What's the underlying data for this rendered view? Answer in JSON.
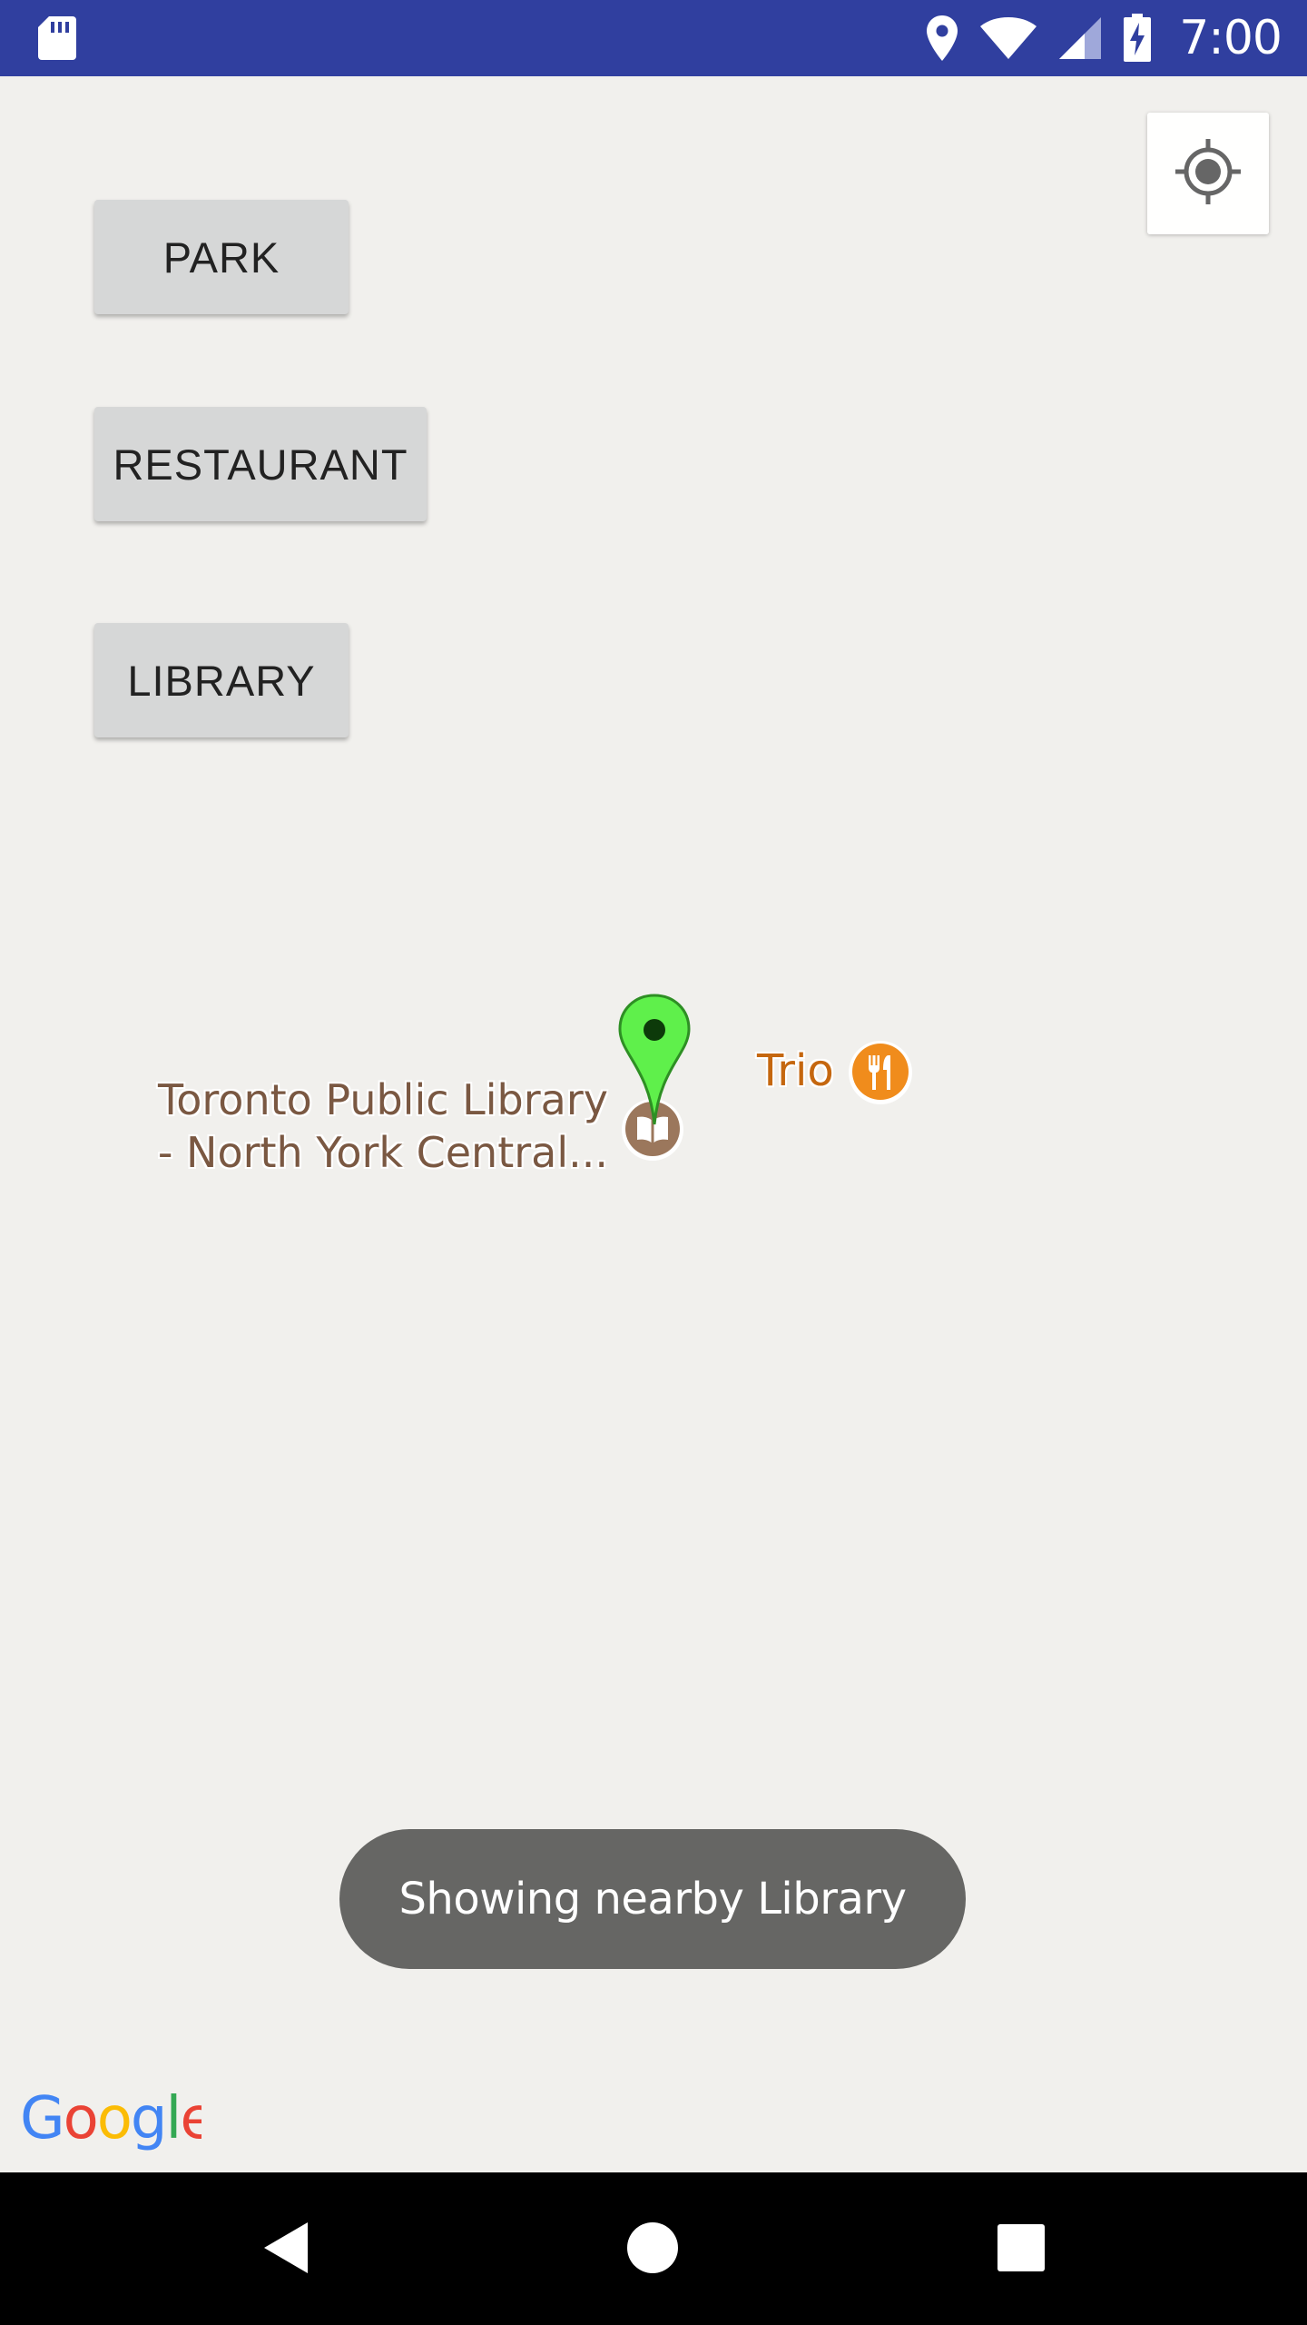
{
  "status_bar": {
    "time": "7:00",
    "icons": [
      "sd-card-icon",
      "location-icon",
      "wifi-icon",
      "signal-icon",
      "battery-charging-icon"
    ],
    "background": "#303f9f"
  },
  "map": {
    "my_location_icon": "my-location-icon",
    "buttons": [
      {
        "label": "PARK"
      },
      {
        "label": "RESTAURANT"
      },
      {
        "label": "LIBRARY"
      }
    ],
    "pois": {
      "library": {
        "line1": "Toronto Public Library",
        "line2": "- North York Central...",
        "icon": "book-icon",
        "color": "#9b775c"
      },
      "restaurant": {
        "label": "Trio",
        "icon": "fork-knife-icon",
        "color": "#f08c1c"
      }
    },
    "marker": {
      "icon": "map-pin-icon",
      "color": "#5ff04b"
    },
    "attribution": "Google"
  },
  "toast": {
    "message": "Showing nearby Library"
  },
  "nav_bar": {
    "icons": [
      "back-icon",
      "home-icon",
      "recents-icon"
    ]
  }
}
